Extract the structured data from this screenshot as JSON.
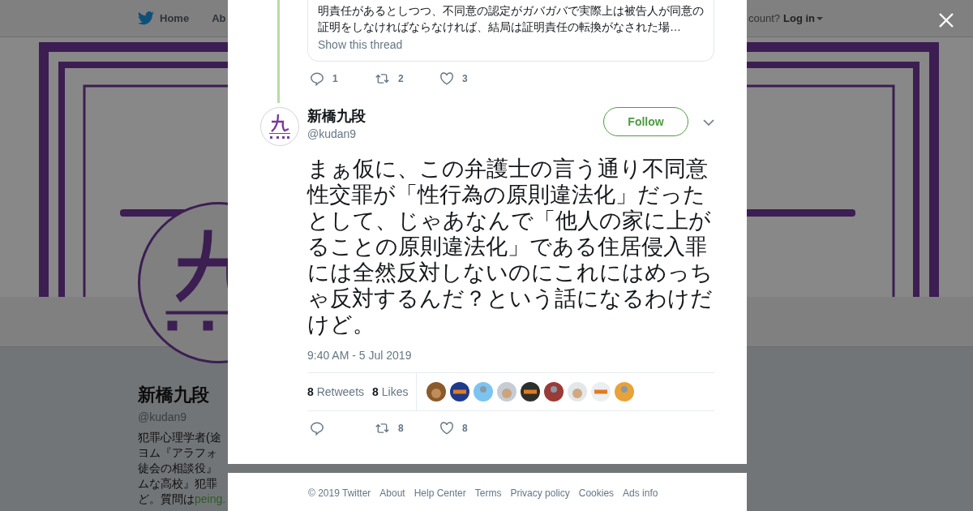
{
  "nav": {
    "items": [
      {
        "label": "Home"
      },
      {
        "label": "Ab"
      }
    ],
    "account_prompt": "count?",
    "login": "Log in"
  },
  "profile": {
    "name": "新橋九段",
    "handle": "@kudan9",
    "bio": [
      "犯罪心理学者(途",
      "ヨム『アラフォ",
      "徒会の相談役』",
      "ムな高校』犯罪"
    ],
    "bio_last": "ど。質問は",
    "bio_link": "peing."
  },
  "modal": {
    "quoted_lines": [
      "明責任があるとしつつ、不同意の認定がガバガバで実際上は被告人が同意の",
      "証明をしなければならなければ、結局は証明責任の転換がなされた場…"
    ],
    "show_thread": "Show this thread",
    "prev_actions": {
      "replies": "1",
      "retweets": "2",
      "likes": "3"
    },
    "tweet": {
      "name": "新橋九段",
      "handle": "@kudan9",
      "follow": "Follow",
      "text": "まぁ仮に、この弁護士の言う通り不同意性交罪が「性行為の原則違法化」だったとして、じゃあなんで「他人の家に上がることの原則違法化」である住居侵入罪には全然反対しないのにこれにはめっちゃ反対するんだ？という話になるわけだけど。",
      "time": "9:40 AM - 5 Jul 2019",
      "retweets_count": "8",
      "retweets_label": "Retweets",
      "likes_count": "8",
      "likes_label": "Likes",
      "likers": [
        {
          "color": "#8a5a2b"
        },
        {
          "color": "#1e3a8a"
        },
        {
          "color": "#7cc4f0"
        },
        {
          "color": "#c5ccd4"
        },
        {
          "color": "#2d2f2c"
        },
        {
          "color": "#9b3a36"
        },
        {
          "color": "#e3e7ea"
        },
        {
          "color": "#eceff1"
        },
        {
          "color": "#e8a23a"
        }
      ],
      "actions": {
        "retweets": "8",
        "likes": "8"
      }
    }
  },
  "footer": [
    "© 2019 Twitter",
    "About",
    "Help Center",
    "Terms",
    "Privacy policy",
    "Cookies",
    "Ads info"
  ]
}
